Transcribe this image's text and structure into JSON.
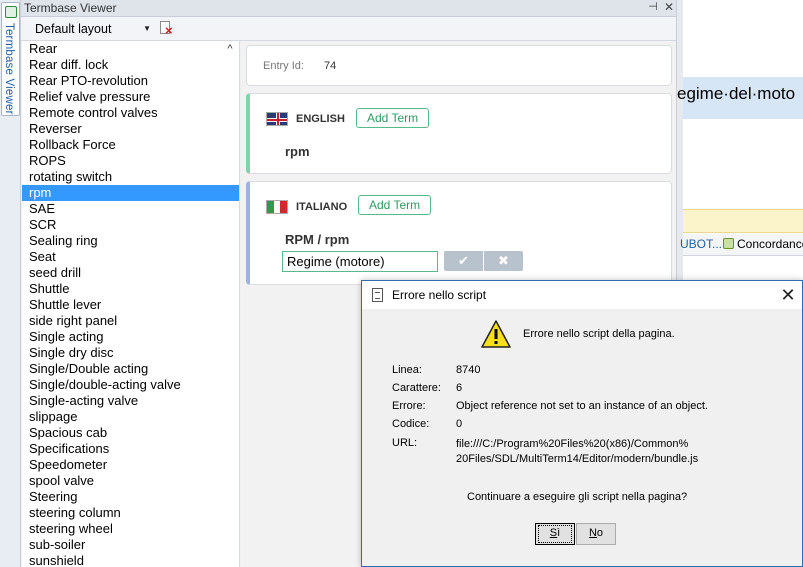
{
  "side_tab": {
    "label": "Termbase Viewer"
  },
  "panel": {
    "title": "Termbase Viewer",
    "pin_glyph": "⊣",
    "close_glyph": "✕"
  },
  "toolbar": {
    "layout": "Default layout"
  },
  "terms": [
    "Rear",
    "Rear diff. lock",
    "Rear PTO-revolution",
    "Relief valve pressure",
    "Remote control valves",
    "Reverser",
    "Rollback Force",
    "ROPS",
    "rotating switch",
    "rpm",
    "SAE",
    "SCR",
    "Sealing ring",
    "Seat",
    "seed drill",
    "Shuttle",
    "Shuttle lever",
    "side right panel",
    "Single acting",
    "Single dry disc",
    "Single/Double acting",
    "Single/double-acting valve",
    "Single-acting valve",
    "slippage",
    "Spacious cab",
    "Specifications",
    "Speedometer",
    "spool valve",
    "Steering",
    "steering column",
    "steering wheel",
    "sub-soiler",
    "sunshield"
  ],
  "selected_term_index": 9,
  "entry": {
    "label": "Entry Id:",
    "value": "74"
  },
  "english": {
    "language": "ENGLISH",
    "add_label": "Add Term",
    "term": "rpm"
  },
  "italian": {
    "language": "ITALIANO",
    "add_label": "Add Term",
    "term": "RPM / rpm",
    "edit_value": "Regime (motore)",
    "ok_glyph": "✔",
    "cancel_glyph": "✖"
  },
  "editor": {
    "segment_text": "egime·del·moto",
    "tab_bubot": "UBOT...",
    "tab_concordance": "Concordance"
  },
  "dialog": {
    "title": "Errore nello script",
    "message": "Errore nello script della pagina.",
    "fields": {
      "line_label": "Linea:",
      "line_value": "8740",
      "char_label": "Carattere:",
      "char_value": "6",
      "error_label": "Errore:",
      "error_value": "Object reference not set to an instance of an object.",
      "code_label": "Codice:",
      "code_value": "0",
      "url_label": "URL:",
      "url_value": "file:///C:/Program%20Files%20(x86)/Common%20Files/SDL/MultiTerm14/Editor/modern/bundle.js"
    },
    "question": "Continuare a eseguire gli script nella pagina?",
    "yes_rest": "ì",
    "no_rest": "o",
    "yes_key": "S",
    "no_key": "N",
    "close_glyph": "✕"
  }
}
